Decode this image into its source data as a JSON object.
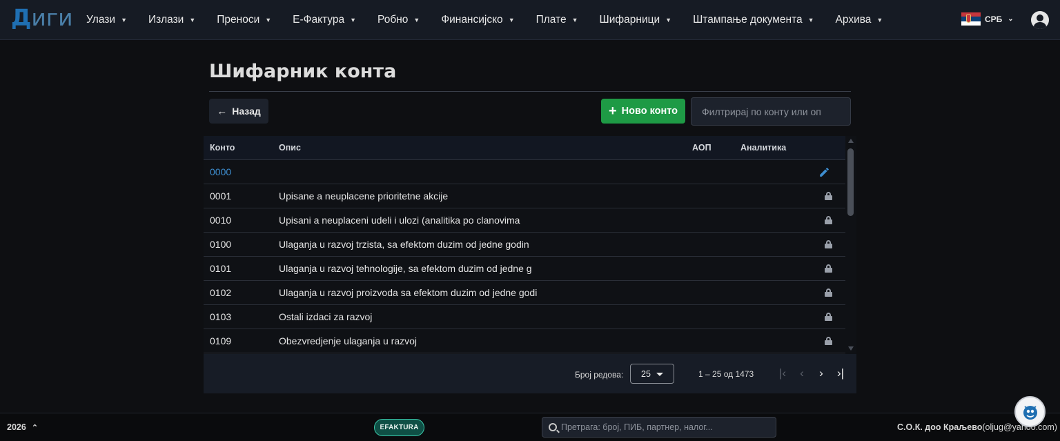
{
  "app": {
    "logo_first": "Д",
    "logo_rest": "иги"
  },
  "nav": [
    {
      "label": "Улази"
    },
    {
      "label": "Излази"
    },
    {
      "label": "Преноси"
    },
    {
      "label": "Е-Фактура"
    },
    {
      "label": "Робно"
    },
    {
      "label": "Финансијско"
    },
    {
      "label": "Плате"
    },
    {
      "label": "Шифарници"
    },
    {
      "label": "Штампање документа"
    },
    {
      "label": "Архива"
    }
  ],
  "language": {
    "code": "СРБ",
    "flag_colors": [
      "#c6363c",
      "#0c4076",
      "#ffffff"
    ]
  },
  "page": {
    "title": "Шифарник конта",
    "back_label": "Назад",
    "new_label": "Ново конто",
    "filter_placeholder": "Филтрирај по конту или оп"
  },
  "table": {
    "columns": [
      "Конто",
      "Опис",
      "АОП",
      "Аналитика"
    ],
    "rows": [
      {
        "konto": "0000",
        "opis": "",
        "action": "edit-icon"
      },
      {
        "konto": "0001",
        "opis": "Upisane a neuplacene prioritetne akcije",
        "action": "lock-icon"
      },
      {
        "konto": "0010",
        "opis": "Upisani a neuplaceni udeli i ulozi (analitika po clanovima",
        "action": "lock-icon"
      },
      {
        "konto": "0100",
        "opis": "Ulaganja u razvoj trzista, sa efektom duzim od jedne godin",
        "action": "lock-icon"
      },
      {
        "konto": "0101",
        "opis": "Ulaganja u razvoj tehnologije, sa efektom duzim od jedne g",
        "action": "lock-icon"
      },
      {
        "konto": "0102",
        "opis": "Ulaganja u razvoj proizvoda sa efektom duzim od jedne godi",
        "action": "lock-icon"
      },
      {
        "konto": "0103",
        "opis": "Ostali izdaci za razvoj",
        "action": "lock-icon"
      },
      {
        "konto": "0109",
        "opis": "Obezvredjenje ulaganja u razvoj",
        "action": "lock-icon"
      }
    ]
  },
  "pagination": {
    "rows_label": "Број редова:",
    "rows_per_page": "25",
    "range": "1 – 25 од 1473"
  },
  "footer": {
    "year": "2026",
    "efaktura": "EFAKTURA",
    "search_placeholder": "Претрага: број, ПИБ, партнер, налог...",
    "company": "С.О.К. доо Краљево",
    "email": "(oljug@yahoo.com)"
  },
  "colors": {
    "accent": "#3e8ed0",
    "new_button": "#1e9a45",
    "efaktura": "#3ac7a8"
  }
}
